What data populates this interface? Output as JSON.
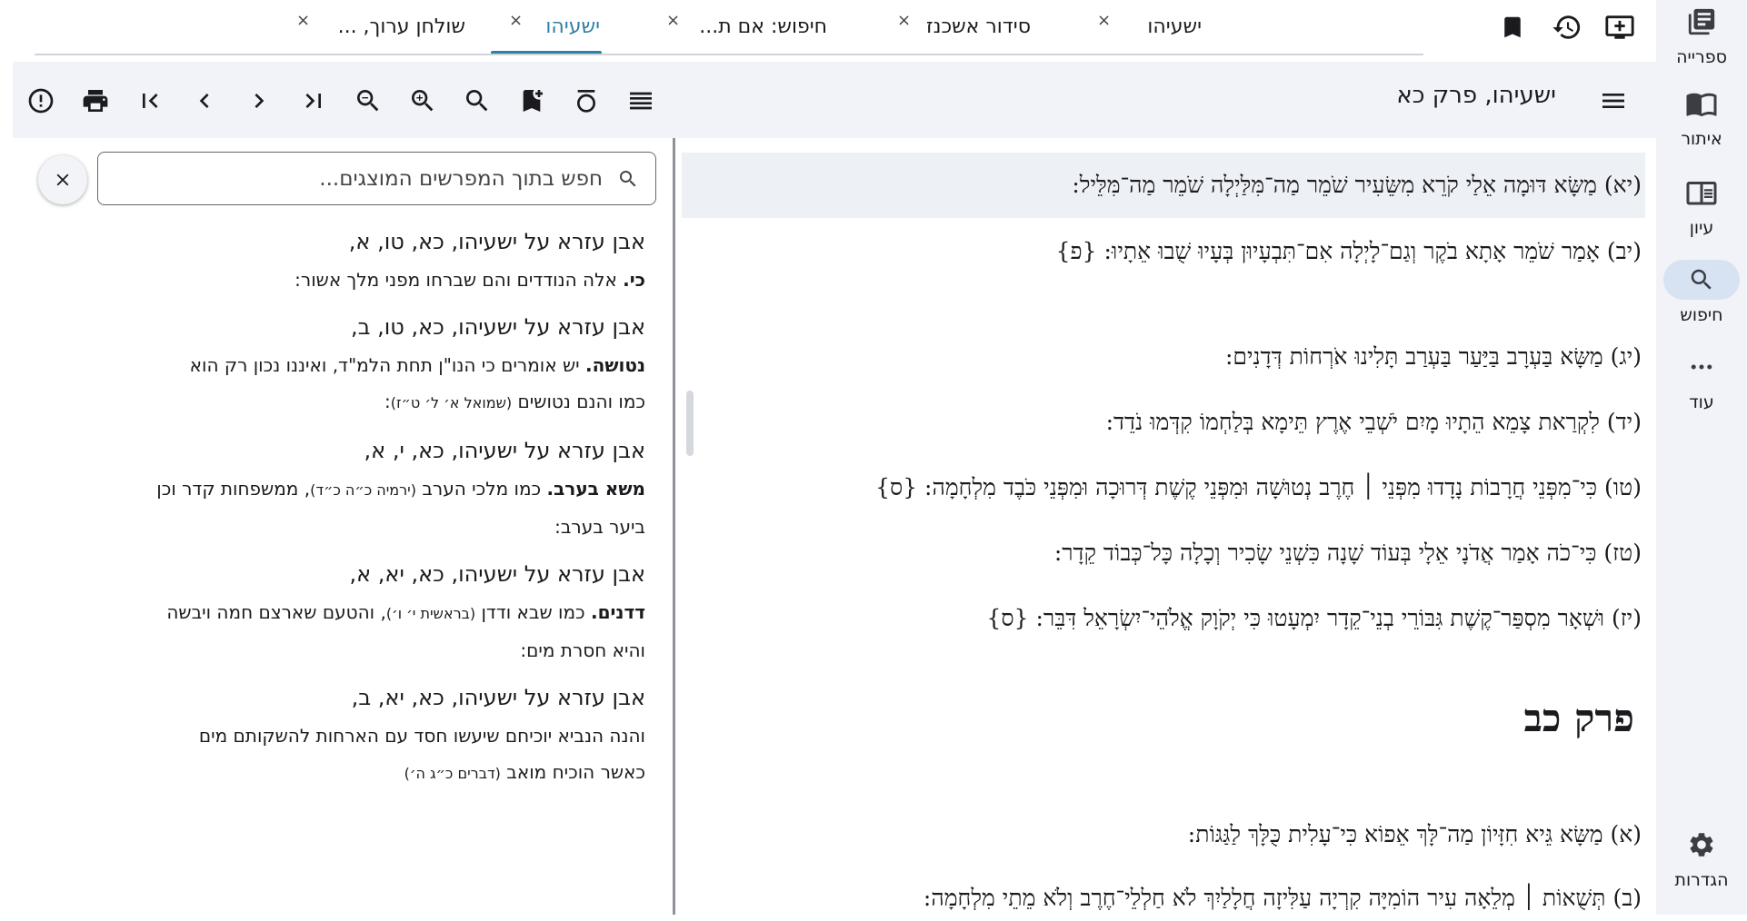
{
  "rail": {
    "library": "ספרייה",
    "locate": "איתור",
    "study": "עיון",
    "search": "חיפוש",
    "more": "עוד",
    "settings": "הגדרות"
  },
  "tabs": [
    {
      "title": "ישעיהו",
      "active": false
    },
    {
      "title": "סידור אשכנז",
      "active": false
    },
    {
      "title": "חיפוש: אם ת...",
      "active": false
    },
    {
      "title": "ישעיהו",
      "active": true
    },
    {
      "title": "שולחן ערוך, ...",
      "active": false
    }
  ],
  "tab_close": "×",
  "toolbar": {
    "book_title": "ישעיהו, פרק כא"
  },
  "commentary": {
    "close_label": "×",
    "search_placeholder": "חפש בתוך המפרשים המוצגים...",
    "entries": [
      {
        "ref": "אבן עזרא על ישעיהו,  כא, טו, א,",
        "bold": "כי.",
        "text": "אלה הנודדים והם שברחו מפני מלך אשור:",
        "line2": ""
      },
      {
        "ref": "אבן עזרא על ישעיהו,  כא, טו, ב,",
        "bold": "נטושה.",
        "text": "יש אומרים כי הנו\"ן תחת הלמ\"ד, ואיננו נכון רק הוא",
        "line2": "כמו והנם נטושים",
        "small": "(שמואל א׳ ל׳ ט״ז)",
        "tail": ":"
      },
      {
        "ref": "אבן עזרא על ישעיהו,  כא, י, א,",
        "bold": "משא בערב.",
        "text": "כמו מלכי הערב",
        "small": "(ירמיה כ״ה כ״ד)",
        "text2": ", ממשפחות קדר וכן",
        "line2": "ביער בערב:"
      },
      {
        "ref": "אבן עזרא על ישעיהו,  כא, יא, א,",
        "bold": "דדנים.",
        "text": "כמו שבא ודדן",
        "small": "(בראשית י׳ ו׳)",
        "text2": ", והטעם שארצם חמה ויבשה",
        "line2": "והיא חסרת מים:"
      },
      {
        "ref": "אבן עזרא על ישעיהו,  כא, יא, ב,",
        "bold": "",
        "text": "והנה הנביא יוכיחם שיעשו חסד עם הארחות להשקותם מים",
        "line2": "כאשר הוכיח מואב",
        "small": "(דברים כ״ג ה׳)"
      }
    ]
  },
  "main_text": {
    "verses_ch21": [
      "(יא) מַשָּׂא דּוּמָה אֵלַי קֹרֵא מִשֵּׂעִיר שֹׁמֵר מַה־מִּלַּיְלָה שֹׁמֵר מַה־מִּלֵּיל:",
      "(יב) אָמַר שֹׁמֵר אָתָא בֹקֶר וְגַם־לָיְלָה אִם־תִּבְעָיוּן בְּעָיוּ שֻׁבוּ אֵתָיוּ: {פ}",
      "(יג) מַשָּׂא בַּעְרָב בַּיַּעַר בַּעְרַב תָּלִינוּ אֹרְחוֹת דְּדָנִים:",
      "(יד) לִקְרַאת צָמֵא הֵתָיוּ מָיִם יֹשְׁבֵי אֶרֶץ תֵּימָא בְּלַחְמוֹ קִדְּמוּ נֹדֵד:",
      "(טו) כִּי־מִפְּנֵי חֲרָבוֹת נָדָדוּ מִפְּנֵי ׀ חֶרֶב נְטוּשָׁה וּמִפְּנֵי קֶשֶׁת דְּרוּכָה וּמִפְּנֵי כֹּבֶד מִלְחָמָה: {ס}",
      "(טז) כִּי־כֹה אָמַר אֲדֹנָי אֵלָי בְּעוֹד שָׁנָה כִּשְׁנֵי שָׂכִיר וְכָלָה כָּל־כְּבוֹד קֵדָר:",
      "(יז) וּשְׁאָר מִסְפַּר־קֶשֶׁת גִּבּוֹרֵי בְנֵי־קֵדָר יִמְעָטוּ כִּי יְקֹוָק אֱלֹהֵי־יִשְׂרָאֵל דִּבֵּר: {ס}"
    ],
    "chapter_heading": "פרק כב",
    "verses_ch22": [
      "(א) מַשָּׂא גֵּיא חִזָּיוֹן מַה־לָּךְ אֵפוֹא כִּי־עָלִית כֻּלָּךְ לַגַּגּוֹת:",
      "(ב) תְּשֻׁאוֹת ׀ מְלֵאָה עִיר הוֹמִיָּה קִרְיָה עַלִּיזָה חֲלָלַיִךְ לֹא חַלְלֵי־חֶרֶב וְלֹא מֵתֵי מִלְחָמָה:"
    ]
  },
  "colors": {
    "accent": "#2f7fa6",
    "rail_bg": "#f1f3f8",
    "toolbar_bg": "#f1f3f8",
    "active_rail_pill": "#d7e2f2",
    "highlight_row": "#edf0f5"
  }
}
